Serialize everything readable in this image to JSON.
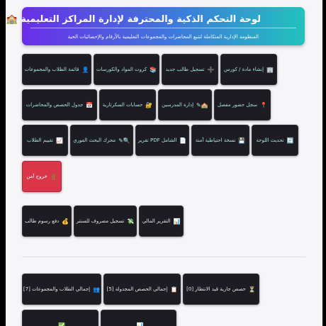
{
  "header": {
    "title": "لوحة التحكم الذكية والمحترفة لإدارة المراكز التعليمية",
    "title_icon": "🏫",
    "subtitle": "المنظومة الإدارية المتكاملة لتتبع المحاضرات والمجموعات التعليمية بالأرقام والإحصائيات الحية"
  },
  "actions": [
    {
      "label": "إنشاء مادة / كورس",
      "icon": "🏢"
    },
    {
      "label": "تسجيل طالب جديد",
      "icon": "➕"
    },
    {
      "label": "كروت المواد والكورسات",
      "icon": "📚"
    },
    {
      "label": "قائمة الطلاب والمجموعات",
      "icon": "👤"
    },
    {
      "label": "سجل حضور مفصل",
      "icon": "📍"
    },
    {
      "label": "إدارة المدرسين",
      "icon": "🏫✎"
    },
    {
      "label": "حسابات السكرتارية",
      "icon": "🔐"
    },
    {
      "label": "جدول الحصص والمحاضرات",
      "icon": "📅"
    },
    {
      "label": "تحديث اللوحة",
      "icon": "🔄"
    },
    {
      "label": "نسخة احتياطية آمنة",
      "icon": "💾"
    },
    {
      "label": "الشامل PDF تقرير",
      "icon": "📄"
    },
    {
      "label": "محرك البحث الفوري",
      "icon": "🔍✎"
    },
    {
      "label": "تقييم الطلاب",
      "icon": "📈"
    },
    {
      "label": "خروج آمن",
      "icon": "🚪"
    }
  ],
  "finance": [
    {
      "label": "التقرير المالي",
      "icon": "📊"
    },
    {
      "label": "تسجيل مصروف للسنتر",
      "icon": "💸"
    },
    {
      "label": "دفع رسوم طالب",
      "icon": "💰"
    }
  ],
  "stats": [
    {
      "label": "حصص جارية قيد الانتظار [0]",
      "icon": "⏳"
    },
    {
      "label": "إجمالي الحصص المجدولة [5]",
      "icon": "📋"
    },
    {
      "label": "إجمالي الطلاب والمجموعات [7]",
      "icon": "👥"
    },
    {
      "label": "",
      "icon": "📊"
    },
    {
      "label": "",
      "icon": "✅"
    }
  ],
  "colors": {
    "header_start": "#6a2ee8",
    "header_end": "#22c2bd",
    "button_bg": "#1c1c22",
    "danger": "#d9364a"
  }
}
